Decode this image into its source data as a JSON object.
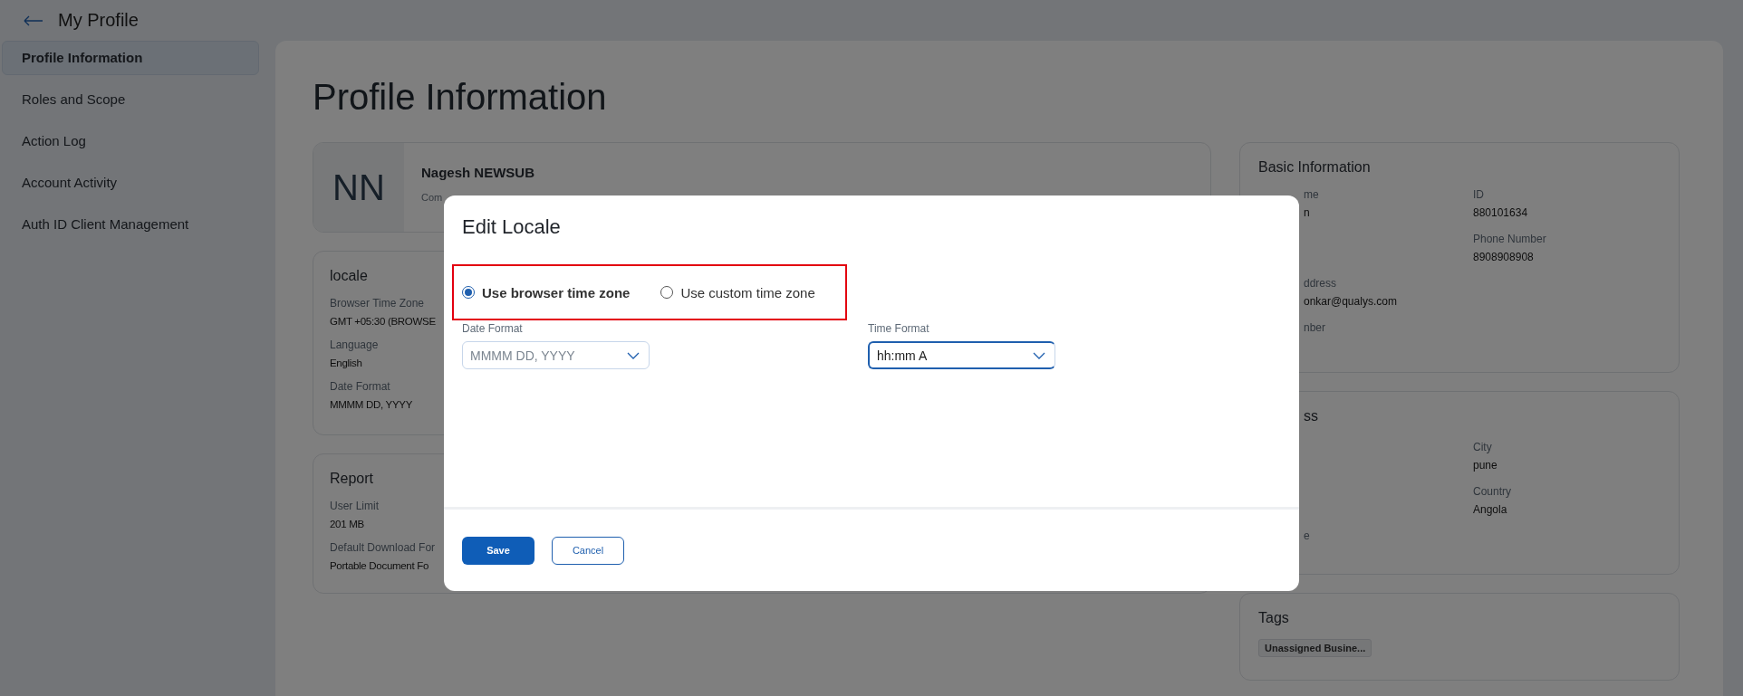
{
  "header": {
    "title": "My Profile"
  },
  "sidebar": {
    "items": [
      {
        "label": "Profile Information",
        "selected": true
      },
      {
        "label": "Roles and Scope",
        "selected": false
      },
      {
        "label": "Action Log",
        "selected": false
      },
      {
        "label": "Account Activity",
        "selected": false
      },
      {
        "label": "Auth ID Client Management",
        "selected": false
      }
    ]
  },
  "page_title": "Profile Information",
  "profile_card": {
    "initials": "NN",
    "name": "Nagesh NEWSUB",
    "subtitle": "Com"
  },
  "locale_card": {
    "title": "locale",
    "fields": [
      {
        "label": "Browser Time Zone",
        "value": "GMT +05:30 (BROWSE"
      },
      {
        "label": "Language",
        "value": "English"
      },
      {
        "label": "Date Format",
        "value": "MMMM DD, YYYY"
      }
    ]
  },
  "report_card": {
    "title": "Report",
    "fields": [
      {
        "label": "User Limit",
        "value": "201 MB"
      },
      {
        "label": "Default Download For",
        "value": "Portable Document Fo"
      }
    ]
  },
  "basic_info_card": {
    "title": "Basic Information",
    "rows": [
      {
        "left": {
          "label": "me",
          "value": "n"
        },
        "right": {
          "label": "ID",
          "value": "880101634"
        }
      },
      {
        "right": {
          "label": "Phone Number",
          "value": "8908908908"
        }
      },
      {
        "left": {
          "label": "ddress",
          "value": "onkar@qualys.com"
        }
      },
      {
        "left": {
          "label": "nber"
        }
      }
    ]
  },
  "address_card": {
    "title": "ss",
    "rows": [
      {
        "right": {
          "label": "City",
          "value": "pune"
        }
      },
      {
        "right": {
          "label": "Country",
          "value": "Angola"
        }
      },
      {
        "left": {
          "label": "e"
        }
      }
    ]
  },
  "tags_card": {
    "title": "Tags",
    "tags": [
      "Unassigned Busine..."
    ]
  },
  "dialog": {
    "title": "Edit Locale",
    "highlighted": true,
    "options": [
      {
        "label": "Use browser time zone",
        "selected": true
      },
      {
        "label": "Use custom time zone",
        "selected": false
      }
    ],
    "fields": [
      {
        "label": "Date Format",
        "value": "MMMM DD, YYYY",
        "focused": false
      },
      {
        "label": "Time Format",
        "value": "hh:mm A",
        "focused": true
      }
    ],
    "buttons": [
      {
        "label": "Save",
        "kind": "primary"
      },
      {
        "label": "Cancel",
        "kind": "secondary"
      }
    ]
  }
}
